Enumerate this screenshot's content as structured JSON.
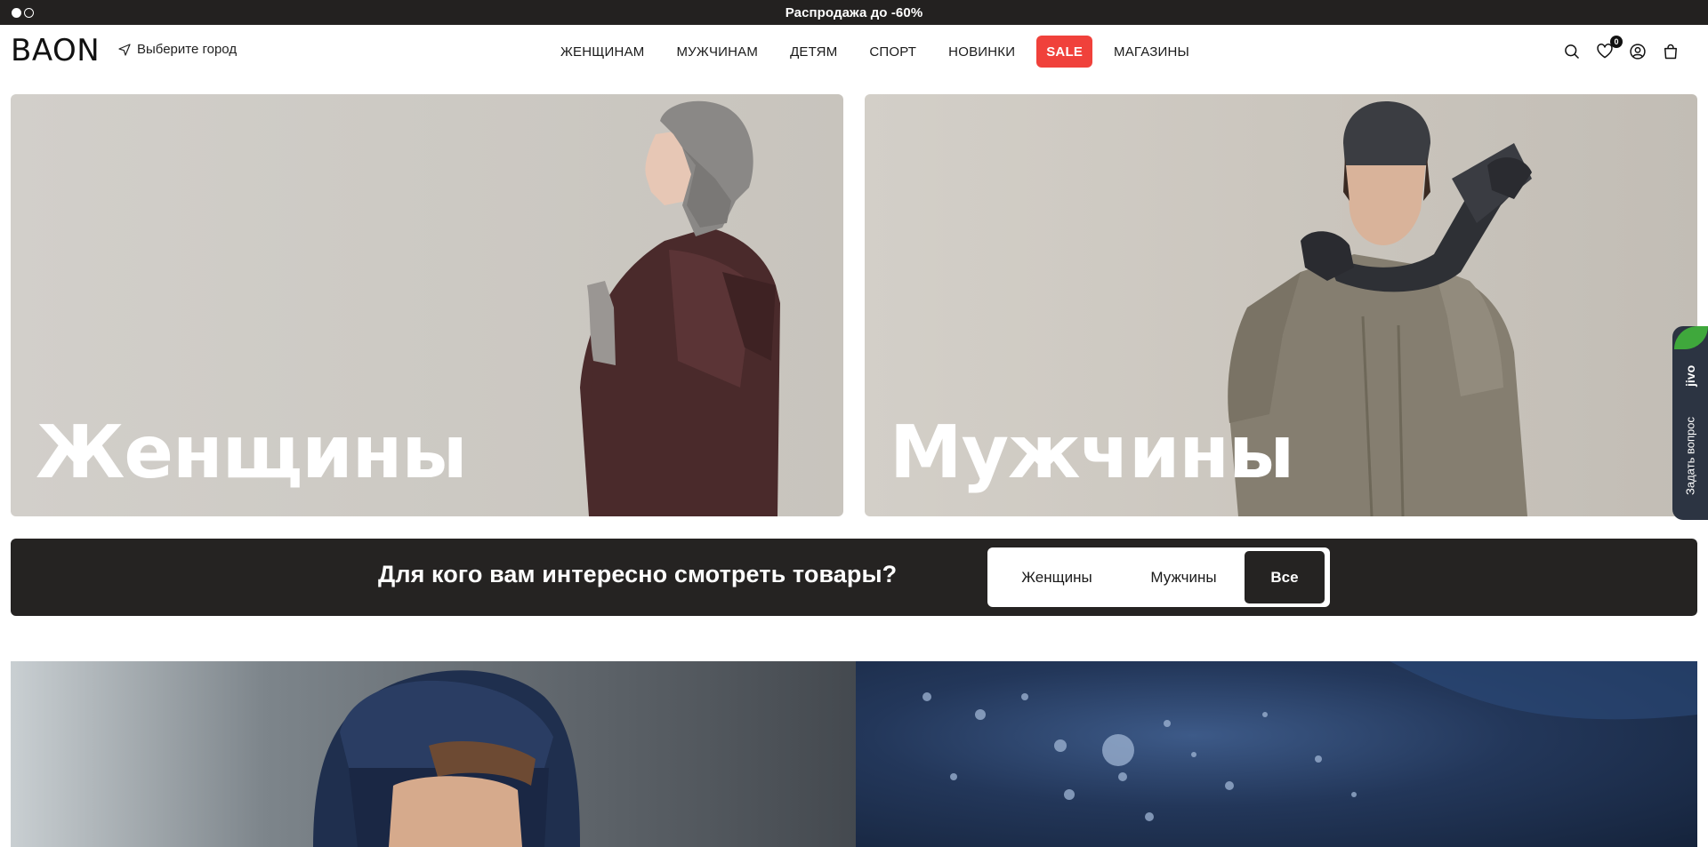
{
  "promo": {
    "text": "Распродажа до -60%"
  },
  "header": {
    "logo": "BAON",
    "city_label": "Выберите город",
    "nav": [
      {
        "label": "ЖЕНЩИНАМ",
        "sale": false
      },
      {
        "label": "МУЖЧИНАМ",
        "sale": false
      },
      {
        "label": "ДЕТЯМ",
        "sale": false
      },
      {
        "label": "СПОРТ",
        "sale": false
      },
      {
        "label": "НОВИНКИ",
        "sale": false
      },
      {
        "label": "SALE",
        "sale": true
      },
      {
        "label": "МАГАЗИНЫ",
        "sale": false
      }
    ],
    "favorites_count": "0"
  },
  "hero": {
    "women_title": "Женщины",
    "men_title": "Мужчины"
  },
  "audience": {
    "question": "Для кого вам интересно смотреть товары?",
    "options": [
      "Женщины",
      "Мужчины",
      "Все"
    ],
    "selected": "Все"
  },
  "chat": {
    "brand": "jivo",
    "label": "Задать вопрос"
  },
  "colors": {
    "sale": "#f0413b",
    "dark": "#252322",
    "chat": "#2c3442",
    "chat_accent": "#3fa83c"
  }
}
